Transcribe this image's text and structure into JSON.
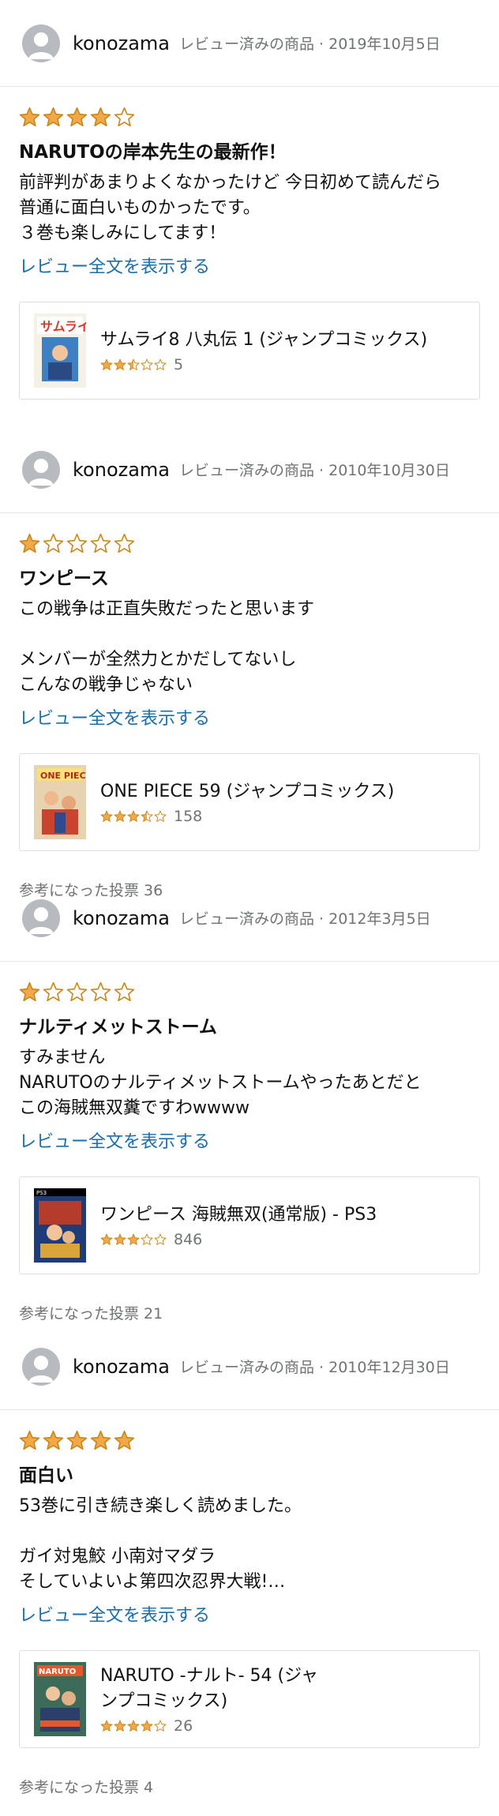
{
  "colors": {
    "star_fill": "#f3a847",
    "star_outline": "#c7861b",
    "link": "#1a6ea8",
    "meta": "#6f7373"
  },
  "reviews": [
    {
      "user": "konozama",
      "meta": "レビュー済みの商品 · 2019年10月5日",
      "rating": 4,
      "title": "NARUTOの岸本先生の最新作！",
      "text": "前評判があまりよくなかったけど 今日初めて読んだら\n普通に面白いものかったです。\n３巻も楽しみにしてます！",
      "read_more": "レビュー全文を表示する",
      "product": {
        "title": "サムライ8 八丸伝 1 (ジャンプコミックス)",
        "rating": 2.5,
        "count": "5",
        "icon": "book-cover-samurai8"
      },
      "helpful": ""
    },
    {
      "user": "konozama",
      "meta": "レビュー済みの商品 · 2010年10月30日",
      "rating": 1,
      "title": "ワンピース",
      "text": "この戦争は正直失敗だったと思います\n\nメンバーが全然力とかだしてないし\nこんなの戦争じゃない",
      "read_more": "レビュー全文を表示する",
      "product": {
        "title": "ONE PIECE 59 (ジャンプコミックス)",
        "rating": 3.5,
        "count": "158",
        "icon": "book-cover-onepiece"
      },
      "helpful": "参考になった投票 36"
    },
    {
      "user": "konozama",
      "meta": "レビュー済みの商品 · 2012年3月5日",
      "rating": 1,
      "title": "ナルティメットストーム",
      "text": "すみません\nNARUTOのナルティメットストームやったあとだと\nこの海賊無双糞ですわwwww",
      "read_more": "レビュー全文を表示する",
      "product": {
        "title": "ワンピース 海賊無双(通常版) - PS3",
        "rating": 3,
        "count": "846",
        "icon": "game-cover-ps3"
      },
      "helpful": "参考になった投票 21"
    },
    {
      "user": "konozama",
      "meta": "レビュー済みの商品 · 2010年12月30日",
      "rating": 5,
      "title": "面白い",
      "text": "53巻に引き続き楽しく読めました。\n\nガイ対鬼鮫 小南対マダラ\nそしていよいよ第四次忍界大戦!…",
      "read_more": "レビュー全文を表示する",
      "product": {
        "title": "NARUTO -ナルト- 54 (ジャンプコミックス)",
        "rating": 4,
        "count": "26",
        "icon": "book-cover-naruto"
      },
      "helpful": "参考になった投票 4"
    }
  ]
}
